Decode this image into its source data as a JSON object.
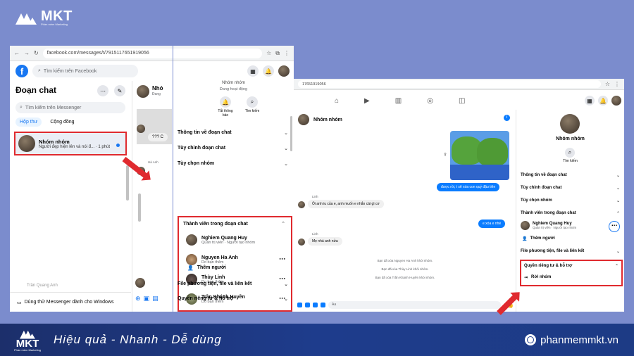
{
  "brand": {
    "name": "MKT",
    "tagline": "Phần mềm Marketing",
    "accent": "#e02a2f",
    "fb_blue": "#1877f2"
  },
  "footer": {
    "slogan": "Hiệu quả - Nhanh  - Dễ dùng",
    "site": "phanmemmkt.vn",
    "globe_icon": "globe-icon"
  },
  "panel1": {
    "url": "facebook.com/messages/t/7915117651919056",
    "fb_search_placeholder": "Tìm kiếm trên Facebook",
    "sidebar": {
      "title": "Đoạn chat",
      "search_placeholder": "Tìm kiếm trên Messenger",
      "tabs": [
        "Hộp thư",
        "Cộng đồng"
      ],
      "conversation": {
        "name": "Nhóm nhóm",
        "last_message": "Người đẹp hiện lên và nói đ...",
        "time": "1 phút"
      },
      "hidden_contact": "Trần Quang Anh",
      "bottom": "Dùng thử Messenger dành cho Windows"
    },
    "middle": {
      "name_fragment": "Nhó",
      "sub_fragment": "Đang",
      "msg_fragment": "??? C",
      "person": "Hà Anh"
    },
    "info": {
      "title_fragment": "Nhóm nhóm",
      "status": "Đang hoạt động",
      "actions": [
        {
          "label": "Tắt thông báo",
          "icon": "bell-icon"
        },
        {
          "label": "Tìm kiếm",
          "icon": "search-icon"
        }
      ],
      "sections": [
        "Thông tin về đoạn chat",
        "Tùy chỉnh đoạn chat",
        "Tùy chọn nhóm"
      ],
      "members_title": "Thành viên trong đoạn chat",
      "members": [
        {
          "name": "Nghiem Quang Huy",
          "role": "Quản trị viên · Người tạo nhóm"
        },
        {
          "name": "Nguyen Ha Anh",
          "role": "Do bạn thêm"
        },
        {
          "name": "Thùy Linh",
          "role": "Do bạn thêm"
        },
        {
          "name": "Trần Khánh Huyền",
          "role": "Do bạn thêm"
        }
      ],
      "add_people": "Thêm người",
      "files": "File phương tiện, file và liên kết",
      "privacy": "Quyền riêng tư & hỗ trợ"
    }
  },
  "panel2": {
    "url": "17651919056",
    "chat_name": "Nhóm nhóm",
    "messages": {
      "me1": "được rồi, t sẽ xóa con quỷ đậu tiên",
      "label1": "Linh",
      "them1": "Ôi anh iu của e, anh muốn e nhắn cái gì cơ",
      "me2": "e xóa e nhé",
      "label2": "Linh",
      "them2": "Mẹ nhá anh nửa"
    },
    "system": [
      "Bạn đã xóa Nguyen Ha Anh khỏi nhóm.",
      "Bạn đã xóa Thùy Linh khỏi nhóm.",
      "Bạn đã xóa Trần Khánh Huyền khỏi nhóm."
    ],
    "composer_placeholder": "Aa",
    "right": {
      "name": "Nhóm nhóm",
      "search_label": "Tìm kiếm",
      "sections": [
        "Thông tin về đoạn chat",
        "Tùy chỉnh đoạn chat",
        "Tùy chọn nhóm",
        "Thành viên trong đoạn chat"
      ],
      "member": {
        "name": "Nghiem Quang Huy",
        "role": "Quản trị viên · Người tạo nhóm"
      },
      "add_people": "Thêm người",
      "files": "File phương tiện, file và liên kết",
      "privacy": "Quyền riêng tư & hỗ trợ",
      "leave": "Rời nhóm"
    }
  }
}
